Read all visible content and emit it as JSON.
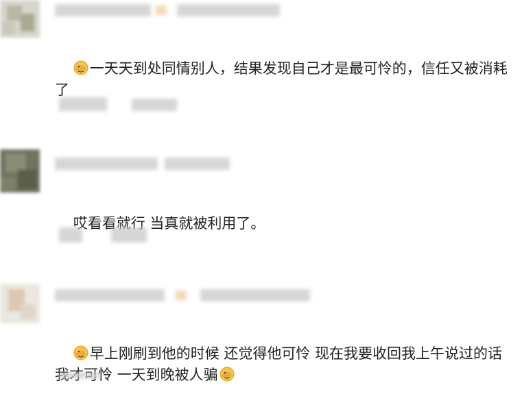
{
  "comments": [
    {
      "text": "一天天到处同情别人，结果发现自己才是最可怜的，信任又被消耗了",
      "has_emoji_prefix": true,
      "emoji": "facepalm-emoji"
    },
    {
      "text": "哎看看就行 当真就被利用了。",
      "has_emoji_prefix": false
    },
    {
      "text": "早上刚刷到他的时候 还觉得他可怜 现在我要收回我上午说过的话 我才可怜 一天到晚被人骗",
      "has_emoji_prefix": true,
      "has_emoji_suffix": true,
      "emoji": "facepalm-emoji"
    }
  ],
  "colors": {
    "text": "#222222",
    "blur": "#cfcfcf",
    "emoji_face": "#f5c542",
    "background": "#ffffff"
  }
}
